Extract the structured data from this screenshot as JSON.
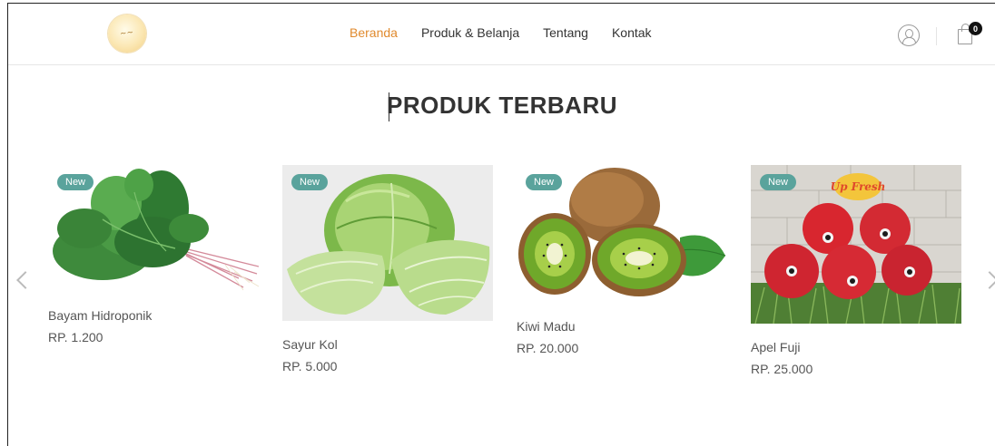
{
  "nav": {
    "items": [
      {
        "label": "Beranda",
        "active": true
      },
      {
        "label": "Produk & Belanja",
        "active": false
      },
      {
        "label": "Tentang",
        "active": false
      },
      {
        "label": "Kontak",
        "active": false
      }
    ]
  },
  "cart": {
    "count": "0"
  },
  "section": {
    "title": "PRODUK TERBARU"
  },
  "products": [
    {
      "badge": "New",
      "name": "Bayam Hidroponik",
      "price": "RP. 1.200"
    },
    {
      "badge": "New",
      "name": "Sayur Kol",
      "price": "RP. 5.000"
    },
    {
      "badge": "New",
      "name": "Kiwi Madu",
      "price": "RP. 20.000"
    },
    {
      "badge": "New",
      "name": "Apel Fuji",
      "price": "RP. 25.000",
      "image_text": "Up Fresh"
    }
  ],
  "colors": {
    "accent": "#e08a2e",
    "badge": "#5aa39c"
  }
}
